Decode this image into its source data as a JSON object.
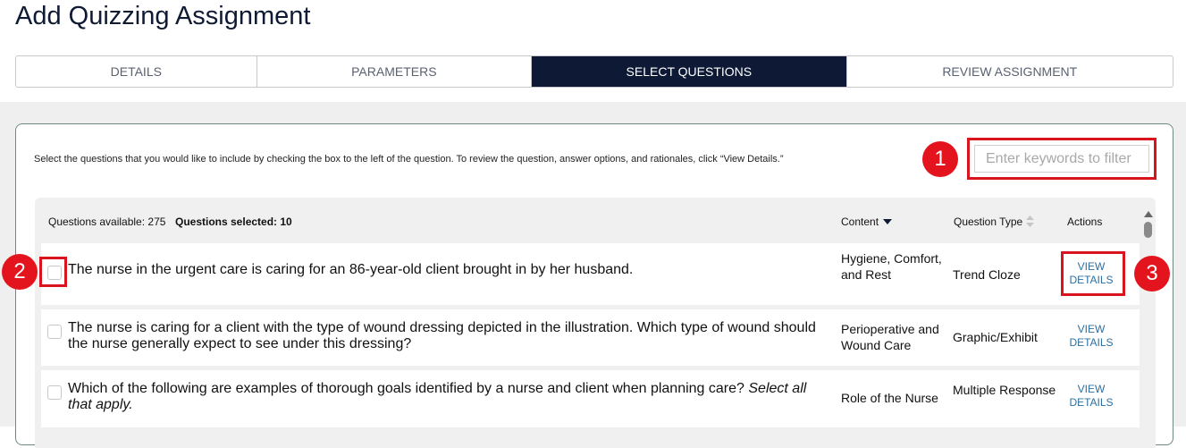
{
  "page_title": "Add Quizzing Assignment",
  "tabs": [
    {
      "label": "DETAILS",
      "active": false
    },
    {
      "label": "PARAMETERS",
      "active": false
    },
    {
      "label": "SELECT QUESTIONS",
      "active": true
    },
    {
      "label": "REVIEW ASSIGNMENT",
      "active": false
    }
  ],
  "instructions": "Select the questions that you would like to include by checking the box to the left of the question. To review the question, answer options, and rationales, click “View Details.”",
  "filter": {
    "placeholder": "Enter keywords to filter",
    "value": ""
  },
  "table": {
    "available_label": "Questions available: 275",
    "selected_label": "Questions selected: 10",
    "columns": {
      "content": "Content",
      "question_type": "Question Type",
      "actions": "Actions"
    },
    "rows": [
      {
        "question": "The nurse in the urgent care is caring for an 86-year-old client brought in by her husband.",
        "content": "Hygiene, Comfort, and Rest",
        "question_type": "Trend Cloze",
        "action": "VIEW DETAILS",
        "checked": false
      },
      {
        "question": "The nurse is caring for a client with the type of wound dressing depicted in the illustration. Which type of wound should the nurse generally expect to see under this dressing?",
        "content": "Perioperative and Wound Care",
        "question_type": "Graphic/Exhibit",
        "action": "VIEW DETAILS",
        "checked": false
      },
      {
        "question": "Which of the following are examples of thorough goals identified by a nurse and client when planning care?",
        "question_em": "Select all that apply.",
        "content": "Role of the Nurse",
        "question_type": "Multiple Response",
        "action": "VIEW DETAILS",
        "checked": false
      }
    ]
  },
  "annotations": [
    {
      "label": "1"
    },
    {
      "label": "2"
    },
    {
      "label": "3"
    }
  ],
  "colors": {
    "accent_dark": "#0d1935",
    "highlight_red": "#d8141e",
    "link_blue": "#2c6fa0"
  }
}
